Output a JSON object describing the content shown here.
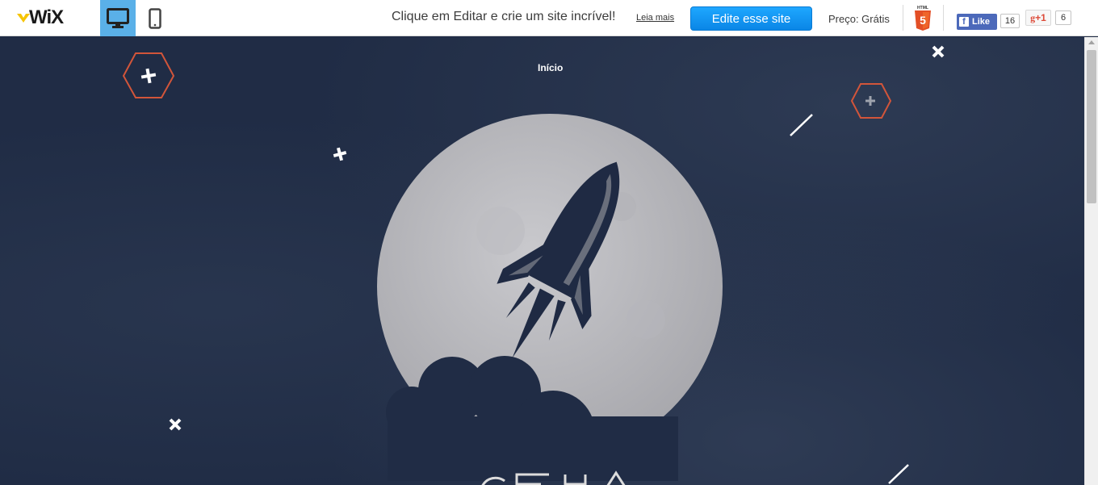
{
  "topbar": {
    "logo_text": "WiX",
    "promo_text": "Clique em Editar e crie um site incrível!",
    "read_more": "Leia mais",
    "edit_button": "Edite esse site",
    "price": "Preço: Grátis",
    "fb_like": "Like",
    "fb_count": "16",
    "gplus_label": "+1",
    "gplus_count": "6",
    "icons": [
      "wix-logo-icon",
      "desktop-view-icon",
      "mobile-view-icon",
      "html5-icon",
      "facebook-icon",
      "google-plus-icon"
    ]
  },
  "site": {
    "nav": {
      "home": "Início"
    }
  },
  "colors": {
    "background": "#202c45",
    "moon": "#b9b9bd",
    "accent_orange": "#d2553a",
    "edit_button": "#0a86e6",
    "desktop_view_active": "#5ab0e8"
  }
}
